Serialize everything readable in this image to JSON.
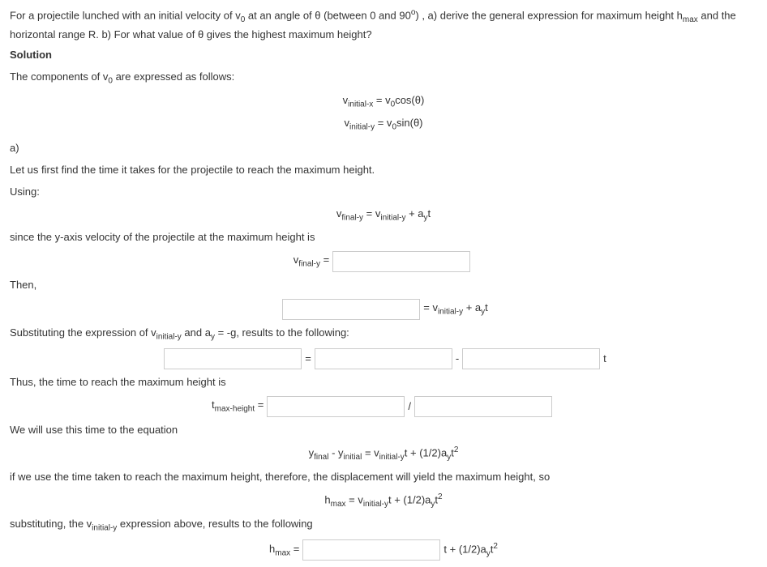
{
  "problem": "For a projectile lunched with an initial velocity of v0 at an angle of θ (between 0 and 90°) , a) derive the general expression for maximum height hmax and the horizontal range R. b) For what value of θ gives the highest maximum height?",
  "solution_label": "Solution",
  "components_intro": "The components of v0 are expressed as follows:",
  "eq_vinitx_lhs": "vinitial-x",
  "eq_vinitx_rhs": " = v0cos(θ)",
  "eq_vinity_lhs": "vinitial-y",
  "eq_vinity_rhs": " = v0sin(θ)",
  "part_a": "a)",
  "let_us_first": "Let us first find the time it takes for the projectile to reach the maximum height.",
  "using": "Using:",
  "eq_vfinaly_lhs": "vfinal-y",
  "eq_vfinaly_mid": " = vinitial-y",
  "eq_vfinaly_rhs": " + ayt",
  "since_y": "since the y-axis velocity of the projectile at the maximum height is",
  "vfinaly_eq": "vfinal-y",
  "equals": " = ",
  "then": "Then,",
  "vinitialy_plus_ayt": " = vinitial-y",
  "plus_ayt": " + ayt",
  "substituting_expr": "Substituting the expression of vinitial-y and ay = -g, results to the following:",
  "minus": " - ",
  "t": " t",
  "thus_time": "Thus, the time to reach the maximum height is",
  "tmaxheight": "tmax-height",
  "slash": " / ",
  "we_will": "We will use this time to the equation",
  "yfinal_eq": "yfinal - yinitial = vinitial-yt + (1/2)ayt",
  "sq": "2",
  "if_we_use": "if we use the time taken to reach the maximum height, therefore, the displacement will yield the maximum height, so",
  "hmax_eq": "hmax",
  "hmax_rhs": " = vinitial-yt + (1/2)ayt",
  "substituting_vinitialy": "substituting, the vinitial-y expression above, results to the following",
  "hmax_final": "hmax",
  "t_plus": "t + (1/2)ayt"
}
